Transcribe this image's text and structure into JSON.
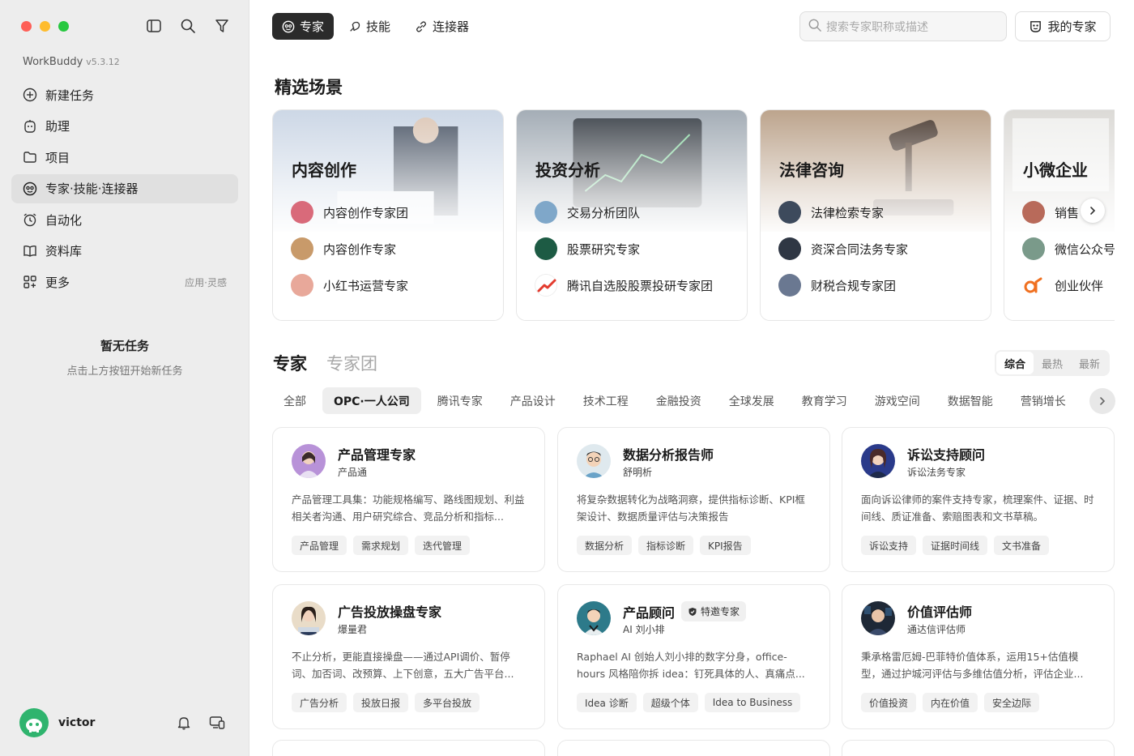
{
  "sidebar": {
    "brand_name": "WorkBuddy",
    "brand_version": "v5.3.12",
    "nav": [
      {
        "label": "新建任务",
        "icon": "plus-circle-icon"
      },
      {
        "label": "助理",
        "icon": "assistant-icon"
      },
      {
        "label": "项目",
        "icon": "folder-icon"
      },
      {
        "label": "专家·技能·连接器",
        "icon": "expert-icon"
      },
      {
        "label": "自动化",
        "icon": "alarm-clock-icon"
      },
      {
        "label": "资料库",
        "icon": "book-icon"
      },
      {
        "label": "更多",
        "icon": "grid-icon",
        "hint": "应用·灵感"
      }
    ],
    "empty_title": "暂无任务",
    "empty_sub": "点击上方按钮开始新任务",
    "user_name": "victor"
  },
  "header": {
    "tabs": [
      "专家",
      "技能",
      "连接器"
    ],
    "search_placeholder": "搜索专家职称或描述",
    "my_experts": "我的专家"
  },
  "featured": {
    "title": "精选场景",
    "scenes": [
      {
        "title": "内容创作",
        "items": [
          "内容创作专家团",
          "内容创作专家",
          "小红书运营专家"
        ]
      },
      {
        "title": "投资分析",
        "items": [
          "交易分析团队",
          "股票研究专家",
          "腾讯自选股股票投研专家团"
        ]
      },
      {
        "title": "法律咨询",
        "items": [
          "法律检索专家",
          "资深合同法务专家",
          "财税合规专家团"
        ]
      },
      {
        "title": "小微企业",
        "items": [
          "销售",
          "微信公众号",
          "创业伙伴"
        ]
      }
    ]
  },
  "experts": {
    "tab_active": "专家",
    "tab_other": "专家团",
    "sort": [
      "综合",
      "最热",
      "最新"
    ],
    "categories": [
      "全部",
      "OPC·一人公司",
      "腾讯专家",
      "产品设计",
      "技术工程",
      "金融投资",
      "全球发展",
      "教育学习",
      "游戏空间",
      "数据智能",
      "营销增长"
    ],
    "cards": [
      {
        "name": "产品管理专家",
        "sub": "产品通",
        "desc": "产品管理工具集：功能规格编写、路线图规划、利益相关者沟通、用户研究综合、竞品分析和指标...",
        "tags": [
          "产品管理",
          "需求规划",
          "迭代管理"
        ]
      },
      {
        "name": "数据分析报告师",
        "sub": "舒明析",
        "desc": "将复杂数据转化为战略洞察，提供指标诊断、KPI框架设计、数据质量评估与决策报告",
        "tags": [
          "数据分析",
          "指标诊断",
          "KPI报告"
        ]
      },
      {
        "name": "诉讼支持顾问",
        "sub": "诉讼法务专家",
        "desc": "面向诉讼律师的案件支持专家，梳理案件、证据、时间线、质证准备、索赔图表和文书草稿。",
        "tags": [
          "诉讼支持",
          "证据时间线",
          "文书准备"
        ]
      },
      {
        "name": "广告投放操盘专家",
        "sub": "爆量君",
        "desc": "不止分析，更能直接操盘——通过API调价、暂停词、加否词、改预算、上下创意，五大广告平台...",
        "tags": [
          "广告分析",
          "投放日报",
          "多平台投放"
        ]
      },
      {
        "name": "产品顾问",
        "badge": "特邀专家",
        "sub": "AI 刘小排",
        "desc": "Raphael AI 创始人刘小排的数字分身，office-hours 风格陪你拆 idea：钉死具体的人、真痛点...",
        "tags": [
          "Idea 诊断",
          "超级个体",
          "Idea to Business"
        ]
      },
      {
        "name": "价值评估师",
        "sub": "通达信评估师",
        "desc": "秉承格雷厄姆-巴菲特价值体系，运用15+估值模型，通过护城河评估与多维估值分析，评估企业...",
        "tags": [
          "价值投资",
          "内在价值",
          "安全边际"
        ]
      }
    ]
  },
  "colors": {
    "sidebar_bg": "#ededed",
    "active_tab": "#2b2b2b",
    "accent_green": "#2fb46e"
  }
}
